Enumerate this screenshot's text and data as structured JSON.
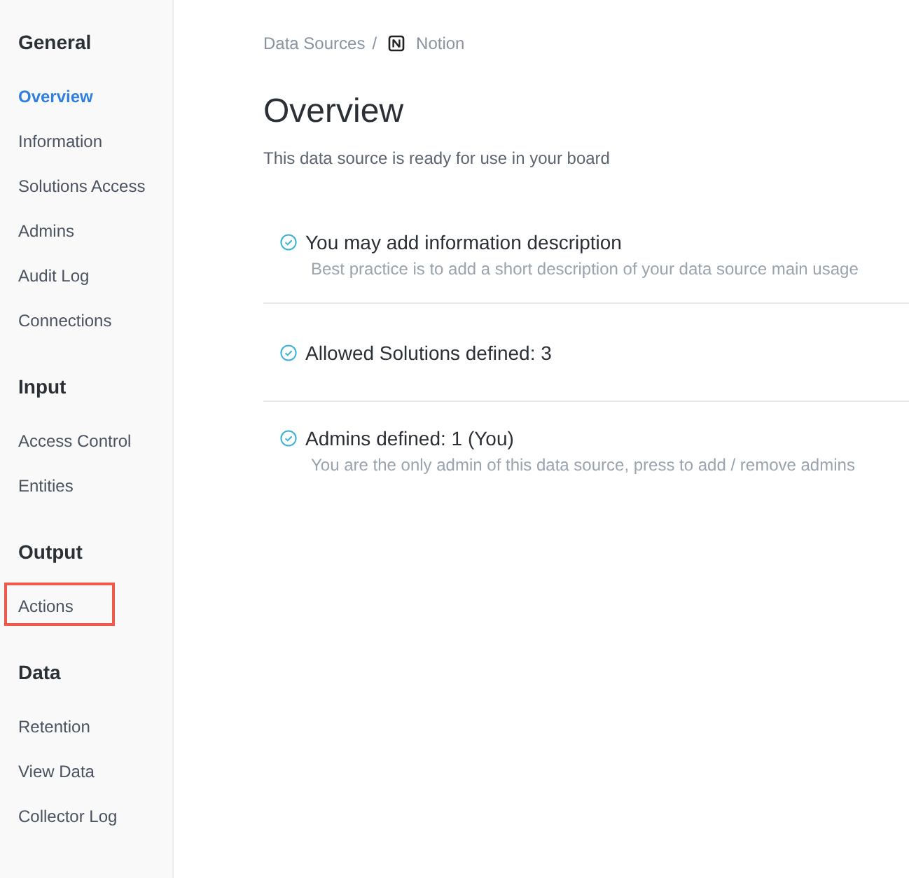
{
  "sidebar": {
    "sections": [
      {
        "heading": "General",
        "items": [
          {
            "label": "Overview",
            "selected": true,
            "highlighted": false
          },
          {
            "label": "Information",
            "selected": false,
            "highlighted": false
          },
          {
            "label": "Solutions Access",
            "selected": false,
            "highlighted": false
          },
          {
            "label": "Admins",
            "selected": false,
            "highlighted": false
          },
          {
            "label": "Audit Log",
            "selected": false,
            "highlighted": false
          },
          {
            "label": "Connections",
            "selected": false,
            "highlighted": false
          }
        ]
      },
      {
        "heading": "Input",
        "items": [
          {
            "label": "Access Control",
            "selected": false,
            "highlighted": false
          },
          {
            "label": "Entities",
            "selected": false,
            "highlighted": false
          }
        ]
      },
      {
        "heading": "Output",
        "items": [
          {
            "label": "Actions",
            "selected": false,
            "highlighted": true
          }
        ]
      },
      {
        "heading": "Data",
        "items": [
          {
            "label": "Retention",
            "selected": false,
            "highlighted": false
          },
          {
            "label": "View Data",
            "selected": false,
            "highlighted": false
          },
          {
            "label": "Collector Log",
            "selected": false,
            "highlighted": false
          }
        ]
      }
    ]
  },
  "breadcrumb": {
    "parent": "Data Sources",
    "separator": "/",
    "current": "Notion"
  },
  "page": {
    "title": "Overview",
    "subtitle": "This data source is ready for use in your board"
  },
  "checklist": [
    {
      "title": "You may add information description",
      "description": "Best practice is to add a short description of your data source main usage",
      "done": true
    },
    {
      "title": "Allowed Solutions defined: 3",
      "done": true
    },
    {
      "title": "Admins defined: 1 (You)",
      "description": "You are the only admin of this data source, press to add / remove admins",
      "done": true
    }
  ]
}
